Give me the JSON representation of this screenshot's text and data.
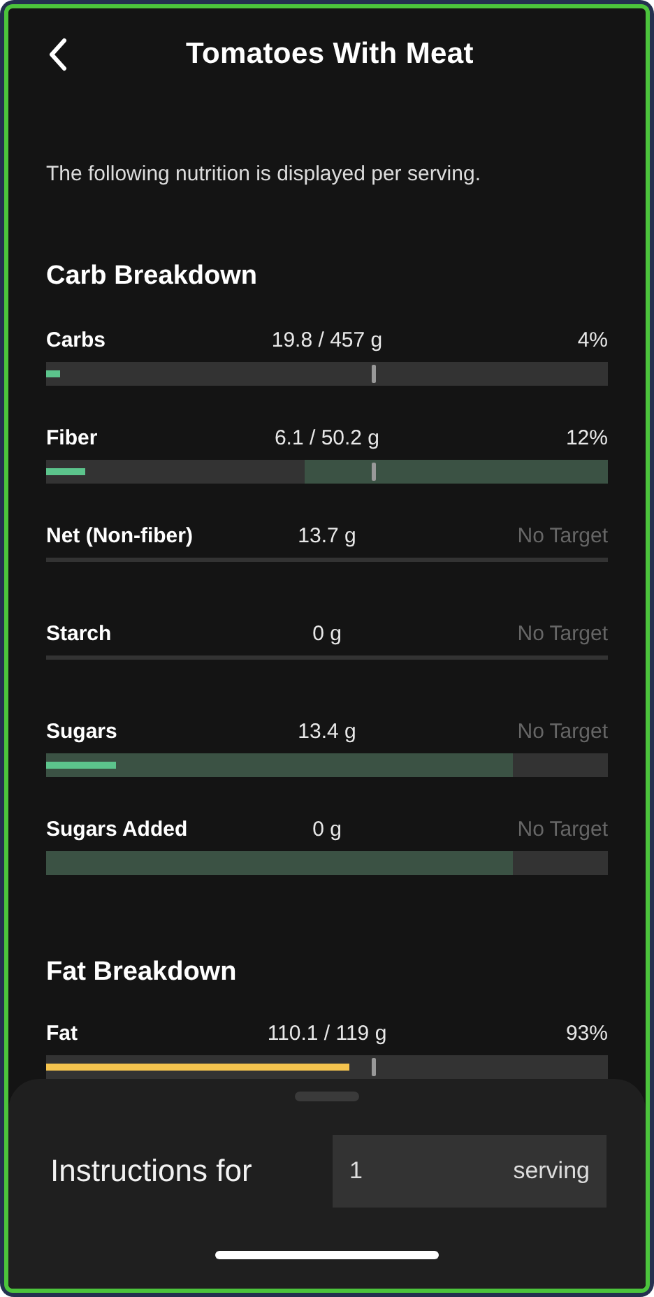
{
  "header": {
    "title": "Tomatoes With Meat"
  },
  "note": "The following nutrition is displayed per serving.",
  "sections": [
    {
      "title": "Carb Breakdown",
      "rows": [
        {
          "name": "Carbs",
          "amount": "19.8 / 457 g",
          "target": "4%",
          "kind": "bar",
          "level": 0.025,
          "marker": true,
          "upper_zone": false,
          "lower_zone": false,
          "has_target": true
        },
        {
          "name": "Fiber",
          "amount": "6.1 / 50.2 g",
          "target": "12%",
          "kind": "bar",
          "level": 0.07,
          "marker": true,
          "upper_zone": true,
          "lower_zone": false,
          "has_target": true
        },
        {
          "name": "Net (Non-fiber)",
          "amount": "13.7 g",
          "target": "No Target",
          "kind": "line",
          "has_target": false
        },
        {
          "name": "Starch",
          "amount": "0 g",
          "target": "No Target",
          "kind": "line",
          "has_target": false
        },
        {
          "name": "Sugars",
          "amount": "13.4 g",
          "target": "No Target",
          "kind": "bar",
          "level": 0.125,
          "marker": false,
          "upper_zone": false,
          "lower_zone": true,
          "has_target": false
        },
        {
          "name": "Sugars Added",
          "amount": "0 g",
          "target": "No Target",
          "kind": "bar",
          "marker": false,
          "upper_zone": false,
          "lower_zone": true,
          "has_target": false
        }
      ]
    },
    {
      "title": "Fat Breakdown",
      "rows": [
        {
          "name": "Fat",
          "amount": "110.1 / 119 g",
          "target": "93%",
          "kind": "bar",
          "level": 0.54,
          "marker": true,
          "upper_zone": false,
          "lower_zone": false,
          "has_target": true,
          "color": "#f5c44e"
        }
      ]
    }
  ],
  "sheet": {
    "label": "Instructions for",
    "quantity": "1",
    "unit": "serving"
  }
}
